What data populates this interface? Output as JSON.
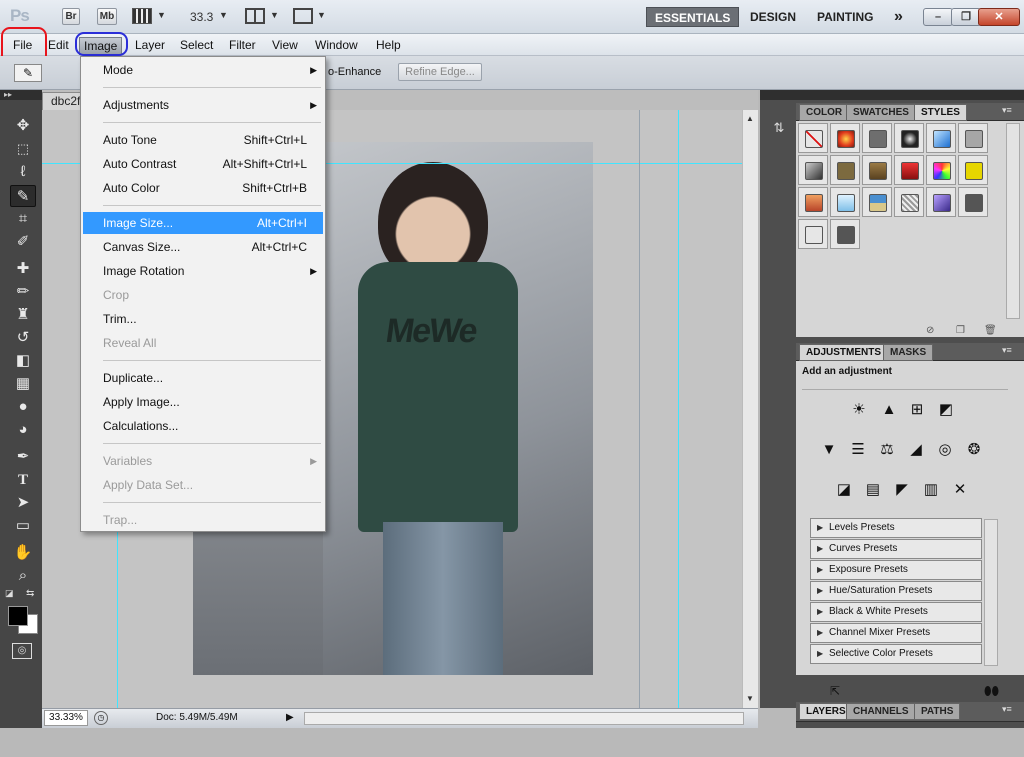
{
  "app": {
    "logo": "Ps",
    "bridge_label": "Br",
    "minibridge_label": "Mb",
    "zoom": "33.3"
  },
  "workspaces": [
    "ESSENTIALS",
    "DESIGN",
    "PAINTING"
  ],
  "workspace_more": "»",
  "window_controls": {
    "minimize": "–",
    "restore": "❐",
    "close": "✕"
  },
  "menubar": [
    "File",
    "Edit",
    "Image",
    "Layer",
    "Select",
    "Filter",
    "View",
    "Window",
    "Help"
  ],
  "options": {
    "auto_enhance": "o-Enhance",
    "refine_edge": "Refine Edge..."
  },
  "document": {
    "tab": "dbc2f",
    "zoom": "33.33%",
    "doc_size": "Doc: 5.49M/5.49M"
  },
  "image_menu": [
    {
      "label": "Mode",
      "shortcut": "",
      "submenu": true,
      "disabled": false
    },
    {
      "sep": true
    },
    {
      "label": "Adjustments",
      "shortcut": "",
      "submenu": true,
      "disabled": false
    },
    {
      "sep": true
    },
    {
      "label": "Auto Tone",
      "shortcut": "Shift+Ctrl+L",
      "disabled": false
    },
    {
      "label": "Auto Contrast",
      "shortcut": "Alt+Shift+Ctrl+L",
      "disabled": false
    },
    {
      "label": "Auto Color",
      "shortcut": "Shift+Ctrl+B",
      "disabled": false
    },
    {
      "sep": true
    },
    {
      "label": "Image Size...",
      "shortcut": "Alt+Ctrl+I",
      "disabled": false,
      "highlight": true
    },
    {
      "label": "Canvas Size...",
      "shortcut": "Alt+Ctrl+C",
      "disabled": false
    },
    {
      "label": "Image Rotation",
      "shortcut": "",
      "submenu": true,
      "disabled": false
    },
    {
      "label": "Crop",
      "shortcut": "",
      "disabled": true
    },
    {
      "label": "Trim...",
      "shortcut": "",
      "disabled": false
    },
    {
      "label": "Reveal All",
      "shortcut": "",
      "disabled": true
    },
    {
      "sep": true
    },
    {
      "label": "Duplicate...",
      "shortcut": "",
      "disabled": false
    },
    {
      "label": "Apply Image...",
      "shortcut": "",
      "disabled": false
    },
    {
      "label": "Calculations...",
      "shortcut": "",
      "disabled": false
    },
    {
      "sep": true
    },
    {
      "label": "Variables",
      "shortcut": "",
      "submenu": true,
      "disabled": true
    },
    {
      "label": "Apply Data Set...",
      "shortcut": "",
      "disabled": true
    },
    {
      "sep": true
    },
    {
      "label": "Trap...",
      "shortcut": "",
      "disabled": true
    }
  ],
  "panels": {
    "styles_tabs": [
      "COLOR",
      "SWATCHES",
      "STYLES"
    ],
    "adjust_tabs": [
      "ADJUSTMENTS",
      "MASKS"
    ],
    "adjust_heading": "Add an adjustment",
    "presets": [
      "Levels Presets",
      "Curves Presets",
      "Exposure Presets",
      "Hue/Saturation Presets",
      "Black & White Presets",
      "Channel Mixer Presets",
      "Selective Color Presets"
    ],
    "layers_tabs": [
      "LAYERS",
      "CHANNELS",
      "PATHS"
    ]
  },
  "photo_text": "MeWe",
  "colors": {
    "menu_highlight": "#3399ff",
    "guide": "#40e5ff",
    "ring_red": "#e8141c",
    "ring_blue": "#2b2ed8"
  }
}
